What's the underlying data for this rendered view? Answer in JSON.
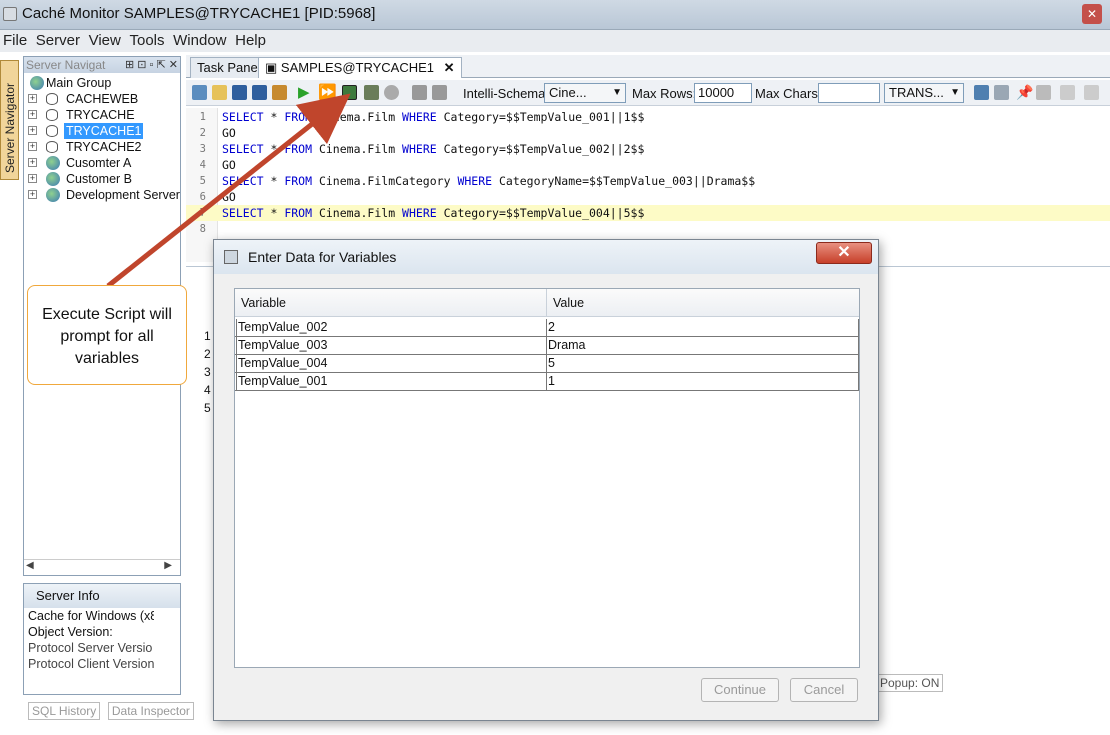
{
  "window": {
    "title": "Caché Monitor  SAMPLES@TRYCACHE1 [PID:5968]"
  },
  "menu": [
    "File",
    "Server",
    "View",
    "Tools",
    "Window",
    "Help"
  ],
  "left_tab": "Server Navigator",
  "navigator": {
    "header": "Server Navigat",
    "root": "Main Group",
    "items": [
      "CACHEWEB",
      "TRYCACHE",
      "TRYCACHE1",
      "TRYCACHE2"
    ],
    "groups": [
      "Cusomter A",
      "Customer B",
      "Development Server"
    ],
    "selected": "TRYCACHE1"
  },
  "server_info": {
    "title": "Server Info",
    "lines": [
      "Cache for Windows (x8",
      "Object Version:",
      "Protocol Server Versio",
      "Protocol Client Version"
    ]
  },
  "bottom_tabs": [
    "SQL History",
    "Data Inspector"
  ],
  "editor_tabs": {
    "task_pane": "Task Pane",
    "samples": "SAMPLES@TRYCACHE1"
  },
  "toolbar": {
    "intelli_label": "Intelli-Schema",
    "intelli_value": "Cine...",
    "max_rows_label": "Max Rows:",
    "max_rows_value": "10000",
    "max_chars_label": "Max Chars:",
    "max_chars_value": "",
    "trans_value": "TRANS..."
  },
  "code_lines": [
    {
      "n": "1",
      "parts": [
        [
          "kw",
          "SELECT"
        ],
        [
          "",
          " * "
        ],
        [
          "kw",
          "FROM"
        ],
        [
          "",
          " Cinema.Film "
        ],
        [
          "kw",
          "WHERE"
        ],
        [
          "",
          " Category=$$TempValue_001||1$$"
        ]
      ]
    },
    {
      "n": "2",
      "parts": [
        [
          "",
          "GO"
        ]
      ]
    },
    {
      "n": "3",
      "parts": [
        [
          "kw",
          "SELECT"
        ],
        [
          "",
          " * "
        ],
        [
          "kw",
          "FROM"
        ],
        [
          "",
          " Cinema.Film "
        ],
        [
          "kw",
          "WHERE"
        ],
        [
          "",
          " Category=$$TempValue_002||2$$"
        ]
      ]
    },
    {
      "n": "4",
      "parts": [
        [
          "",
          "GO"
        ]
      ]
    },
    {
      "n": "5",
      "parts": [
        [
          "kw",
          "SELECT"
        ],
        [
          "",
          " * "
        ],
        [
          "kw",
          "FROM"
        ],
        [
          "",
          " Cinema.FilmCategory "
        ],
        [
          "kw",
          "WHERE"
        ],
        [
          "",
          " CategoryName=$$TempValue_003||Drama$$"
        ]
      ]
    },
    {
      "n": "6",
      "parts": [
        [
          "",
          "GO"
        ]
      ]
    },
    {
      "n": "7",
      "parts": [
        [
          "kw",
          "SELECT"
        ],
        [
          "",
          " * "
        ],
        [
          "kw",
          "FROM"
        ],
        [
          "",
          " Cinema.Film "
        ],
        [
          "kw",
          "WHERE"
        ],
        [
          "",
          " Category=$$TempValue_004||5$$"
        ]
      ]
    },
    {
      "n": "8",
      "parts": []
    }
  ],
  "result_row_numbers": [
    "1",
    "2",
    "3",
    "4",
    "5"
  ],
  "popup_indicator": "Popup: ON",
  "callout": "Execute Script will prompt for all variables",
  "dialog": {
    "title": "Enter Data for Variables",
    "col_variable": "Variable",
    "col_value": "Value",
    "rows": [
      {
        "variable": "TempValue_002",
        "value": "2"
      },
      {
        "variable": "TempValue_003",
        "value": "Drama"
      },
      {
        "variable": "TempValue_004",
        "value": "5"
      },
      {
        "variable": "TempValue_001",
        "value": "1"
      }
    ],
    "continue_label": "Continue",
    "cancel_label": "Cancel",
    "close_glyph": "✕"
  },
  "colors": {
    "keyword": "#0000d0",
    "highlight_line": "#fdfbc6",
    "selection": "#3399ff",
    "arrow": "#c0452c",
    "callout_border": "#f0a83c"
  }
}
